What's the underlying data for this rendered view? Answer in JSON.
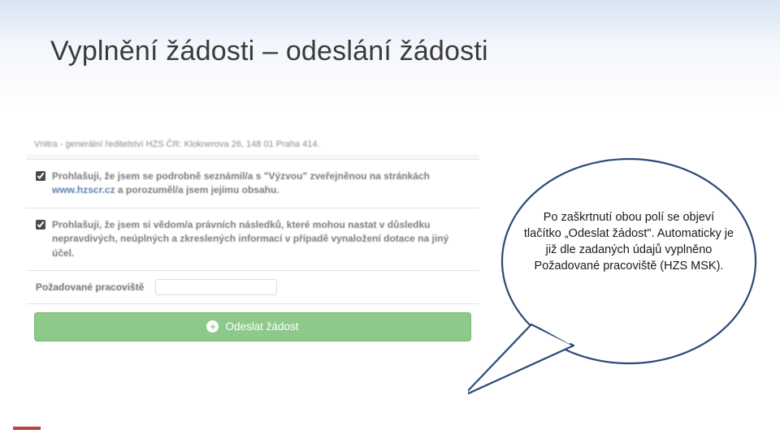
{
  "slide": {
    "title": "Vyplnění žádosti – odeslání žádosti"
  },
  "form": {
    "address_strip": "Vnitra - generální ředitelství HZS ČR: Kloknerova 26, 148 01 Praha 414.",
    "decl1_a": "Prohlašuji, že jsem se podrobně seznámil/a s \"Výzvou\" zveřejněnou na stránkách ",
    "decl1_link": "www.hzscr.cz",
    "decl1_b": " a porozuměl/a jsem jejímu obsahu.",
    "decl2": "Prohlašuji, že jsem si vědom/a právních následků, které mohou nastat v důsledku nepravdivých, neúplných a zkreslených informací v případě vynaložení dotace na jiný účel.",
    "workplace_label": "Požadované pracoviště",
    "submit_label": "Odeslat žádost"
  },
  "callout": {
    "text": "Po zaškrtnutí obou polí se objeví tlačítko „Odeslat žádost\". Automaticky je již dle zadaných údajů vyplněno Požadované pracoviště (HZS MSK)."
  }
}
